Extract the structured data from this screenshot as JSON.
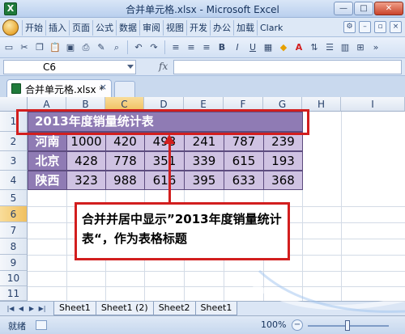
{
  "window": {
    "title": "合并单元格.xlsx - Microsoft Excel",
    "buttons": {
      "minimize": "—",
      "maximize": "□",
      "close": "✕"
    }
  },
  "menu_tabs": [
    "开始",
    "插入",
    "页面",
    "公式",
    "数据",
    "审阅",
    "视图",
    "开发",
    "办公",
    "加载",
    "Clark"
  ],
  "formula_bar": {
    "name_box": "C6",
    "fx": "fx",
    "value": ""
  },
  "document_tab": {
    "label": "合并单元格.xlsx *",
    "close": "×"
  },
  "columns": [
    "A",
    "B",
    "C",
    "D",
    "E",
    "F",
    "G",
    "H",
    "I"
  ],
  "rows": [
    "1",
    "2",
    "3",
    "4",
    "5",
    "6",
    "7",
    "8",
    "9",
    "10",
    "11"
  ],
  "selected": {
    "column": "C",
    "row": "6"
  },
  "table": {
    "title": "2013年度销量统计表",
    "data": [
      [
        "河南",
        "1000",
        "420",
        "493",
        "241",
        "787",
        "239"
      ],
      [
        "北京",
        "428",
        "778",
        "351",
        "339",
        "615",
        "193"
      ],
      [
        "陕西",
        "323",
        "988",
        "616",
        "395",
        "633",
        "368"
      ]
    ],
    "colors": {
      "header": "#8f7bb4",
      "body": "#cfc2e2"
    }
  },
  "annotation": {
    "text": "合并并居中显示”2013年度销量统计表“，作为表格标题",
    "color": "#d21e1e"
  },
  "sheet_tabs": [
    "Sheet1",
    "Sheet1 (2)",
    "Sheet2",
    "Sheet1"
  ],
  "status": {
    "text": "就绪",
    "zoom": "100%"
  }
}
